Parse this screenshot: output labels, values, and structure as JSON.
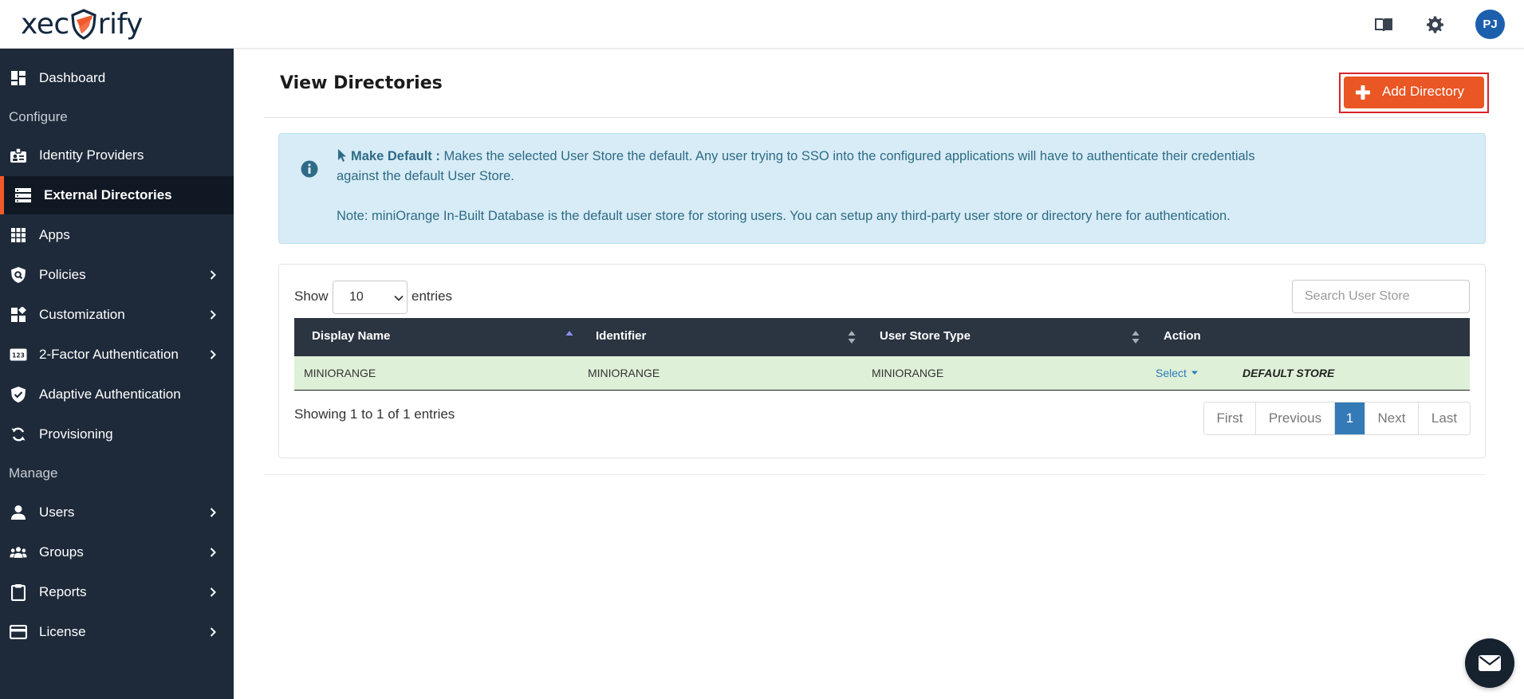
{
  "header": {
    "logo_text_left": "xec",
    "logo_text_right": "rify",
    "avatar_initials": "PJ",
    "icons": [
      "book-icon",
      "gear-icon"
    ]
  },
  "sidebar": {
    "items": [
      {
        "label": "Dashboard",
        "icon": "dashboard-icon"
      },
      {
        "label": "Identity Providers",
        "icon": "id-card-icon"
      },
      {
        "label": "External Directories",
        "icon": "server-icon",
        "active": true
      },
      {
        "label": "Apps",
        "icon": "grid-icon"
      },
      {
        "label": "Policies",
        "icon": "shield-search-icon",
        "chevron": true
      },
      {
        "label": "Customization",
        "icon": "blocks-icon",
        "chevron": true
      },
      {
        "label": "2-Factor Authentication",
        "icon": "code-123-icon",
        "chevron": true
      },
      {
        "label": "Adaptive Authentication",
        "icon": "shield-check-icon"
      },
      {
        "label": "Provisioning",
        "icon": "sync-icon"
      },
      {
        "label": "Users",
        "icon": "user-icon",
        "chevron": true
      },
      {
        "label": "Groups",
        "icon": "group-icon",
        "chevron": true
      },
      {
        "label": "Reports",
        "icon": "clipboard-icon",
        "chevron": true
      },
      {
        "label": "License",
        "icon": "card-icon",
        "chevron": true
      }
    ],
    "sections": [
      "Configure",
      "Manage"
    ]
  },
  "main": {
    "title": "View Directories",
    "add_button_label": "Add Directory",
    "info": {
      "strong": "Make Default :",
      "line1": " Makes the selected User Store the default. Any user trying to SSO into the configured applications will have to authenticate their credentials",
      "line2": "against the default User Store.",
      "note": "Note: miniOrange In-Built Database is the default user store for storing users. You can setup any third-party user store or directory here for authentication."
    },
    "table": {
      "show_label": "Show",
      "entries_value": "10",
      "entries_label": "entries",
      "search_placeholder": "Search User Store",
      "columns": [
        "Display Name",
        "Identifier",
        "User Store Type",
        "Action"
      ],
      "rows": [
        {
          "display_name": "MINIORANGE",
          "identifier": "MINIORANGE",
          "type": "MINIORANGE",
          "action": "Select",
          "status": "DEFAULT STORE"
        }
      ],
      "showing_text": "Showing 1 to 1 of 1 entries",
      "pagination": [
        "First",
        "Previous",
        "1",
        "Next",
        "Last"
      ],
      "current_page": "1"
    }
  },
  "colors": {
    "sidebar_bg": "#1e2a3a",
    "accent": "#ea5624",
    "info_bg": "#d7ecf6",
    "row_highlight": "#dff0d8",
    "table_header": "#2b3441"
  }
}
